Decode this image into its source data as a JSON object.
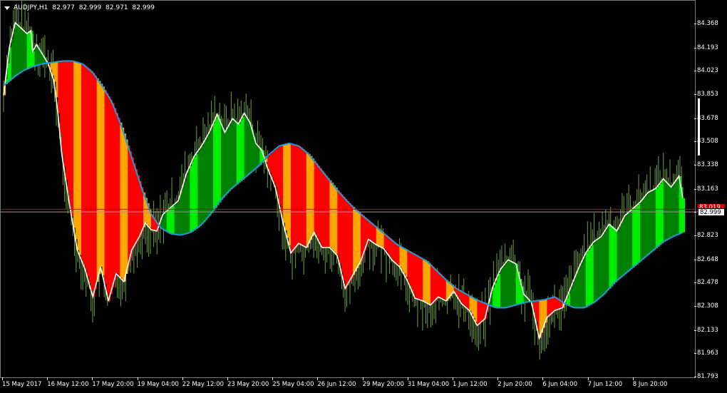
{
  "header": {
    "symbol": "AUDJPY,H1",
    "ohlc": [
      "82.977",
      "82.999",
      "82.971",
      "82.999"
    ]
  },
  "price_axis": {
    "ticks": [
      "84.368",
      "84.193",
      "84.023",
      "83.853",
      "83.678",
      "83.508",
      "83.338",
      "83.163",
      "82.993",
      "82.823",
      "82.648",
      "82.478",
      "82.308",
      "82.133",
      "81.963",
      "81.793"
    ]
  },
  "time_axis": {
    "ticks": [
      "15 May 2017",
      "16 May 12:00",
      "17 May 20:00",
      "19 May 04:00",
      "22 May 12:00",
      "23 May 20:00",
      "25 May 04:00",
      "26 Jun 12:00",
      "29 May 20:00",
      "31 May 04:00",
      "1 Jun 12:00",
      "2 Jun 20:00",
      "6 Jun 04:00",
      "7 Jun 12:00",
      "8 Jun 20:00"
    ]
  },
  "bid_price": "82.999",
  "ask_price": "83.019",
  "colors": {
    "background": "#000000",
    "bull": "#008000",
    "bull_bright": "#00ee00",
    "bear": "#ff0000",
    "bear_alt": "#ffa500",
    "ma_line": "#1e9bdc",
    "price_line": "#ffffff",
    "candles": "#7fbf3f",
    "ask_line": "#d00000"
  },
  "chart_data": {
    "type": "line",
    "title": "",
    "x": [
      0,
      3,
      6,
      9,
      12,
      14,
      15,
      17,
      20,
      23,
      26,
      28,
      30,
      34,
      38,
      42,
      46,
      50,
      54,
      58,
      62,
      66,
      70,
      73,
      76,
      79,
      82,
      86,
      90,
      94,
      98,
      102,
      106,
      110,
      114,
      118,
      121,
      124,
      127,
      130,
      133,
      136,
      140,
      144,
      148,
      152,
      156,
      160,
      164,
      168,
      172,
      176,
      180,
      184,
      188,
      192,
      196,
      200,
      204,
      208,
      212,
      216,
      220,
      224,
      228,
      232,
      236,
      240,
      244,
      248,
      252,
      256,
      260,
      264,
      268,
      272,
      276,
      280,
      284,
      288,
      292,
      296,
      300,
      304,
      308,
      312,
      316,
      320,
      324,
      328,
      332,
      336,
      340,
      344,
      348,
      350
    ],
    "series": [
      {
        "name": "Price",
        "values": [
          83.85,
          84.2,
          84.38,
          84.34,
          84.3,
          84.32,
          84.17,
          84.22,
          84.15,
          84.08,
          83.95,
          83.72,
          83.42,
          83.05,
          82.72,
          82.58,
          82.38,
          82.6,
          82.35,
          82.55,
          82.49,
          82.72,
          82.82,
          82.92,
          82.87,
          82.86,
          82.98,
          83.03,
          83.08,
          83.27,
          83.4,
          83.48,
          83.58,
          83.71,
          83.58,
          83.68,
          83.64,
          83.72,
          83.65,
          83.5,
          83.45,
          83.32,
          83.18,
          82.92,
          82.7,
          82.77,
          82.74,
          82.85,
          82.74,
          82.74,
          82.68,
          82.44,
          82.54,
          82.64,
          82.8,
          82.76,
          82.73,
          82.65,
          82.6,
          82.5,
          82.37,
          82.35,
          82.32,
          82.38,
          82.35,
          82.42,
          82.33,
          82.28,
          82.17,
          82.22,
          82.45,
          82.58,
          82.65,
          82.62,
          82.4,
          82.34,
          82.08,
          82.23,
          82.28,
          82.3,
          82.44,
          82.58,
          82.7,
          82.78,
          82.82,
          82.91,
          82.86,
          82.97,
          83.02,
          83.07,
          83.14,
          83.17,
          83.24,
          83.18,
          83.26,
          83.1
        ]
      },
      {
        "name": "MA",
        "values": [
          83.92,
          83.98,
          84.03,
          84.06,
          84.08,
          84.09,
          84.1,
          84.1,
          84.08,
          84.02,
          83.92,
          83.8,
          83.62,
          83.4,
          83.18,
          82.98,
          82.88,
          82.84,
          82.83,
          82.85,
          82.9,
          82.98,
          83.08,
          83.16,
          83.22,
          83.28,
          83.34,
          83.42,
          83.48,
          83.5,
          83.48,
          83.42,
          83.33,
          83.24,
          83.15,
          83.07,
          83.0,
          82.94,
          82.88,
          82.82,
          82.76,
          82.72,
          82.68,
          82.64,
          82.57,
          82.5,
          82.44,
          82.4,
          82.36,
          82.33,
          82.3,
          82.3,
          82.32,
          82.34,
          82.35,
          82.36,
          82.38,
          82.33,
          82.3,
          82.3,
          82.34,
          82.4,
          82.48,
          82.54,
          82.6,
          82.66,
          82.72,
          82.78,
          82.82,
          82.85
        ]
      }
    ],
    "ylim": [
      81.793,
      84.368
    ]
  }
}
